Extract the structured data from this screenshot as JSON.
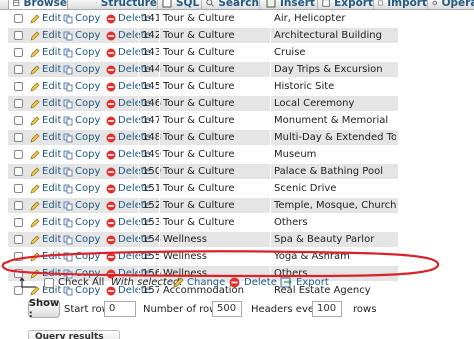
{
  "tabs": [
    {
      "label": "Browse",
      "icon": "browse-icon"
    },
    {
      "label": "Structure",
      "icon": "structure-icon"
    },
    {
      "label": "SQL",
      "icon": "sql-icon"
    },
    {
      "label": "Search",
      "icon": "search-icon"
    },
    {
      "label": "Insert",
      "icon": "insert-icon"
    },
    {
      "label": "Export",
      "icon": "export-icon"
    },
    {
      "label": "Import",
      "icon": "import-icon"
    },
    {
      "label": "Operations",
      "icon": "operations-icon"
    }
  ],
  "actions": {
    "edit": "Edit",
    "copy": "Copy",
    "delete": "Delete"
  },
  "rows": [
    {
      "id": "141",
      "category": "Tour & Culture",
      "name": "Air, Helicopter"
    },
    {
      "id": "142",
      "category": "Tour & Culture",
      "name": "Architectural Building"
    },
    {
      "id": "143",
      "category": "Tour & Culture",
      "name": "Cruise"
    },
    {
      "id": "144",
      "category": "Tour & Culture",
      "name": "Day Trips & Excursion"
    },
    {
      "id": "145",
      "category": "Tour & Culture",
      "name": "Historic Site"
    },
    {
      "id": "146",
      "category": "Tour & Culture",
      "name": "Local Ceremony"
    },
    {
      "id": "147",
      "category": "Tour & Culture",
      "name": "Monument & Memorial"
    },
    {
      "id": "148",
      "category": "Tour & Culture",
      "name": "Multi-Day & Extended Tour"
    },
    {
      "id": "149",
      "category": "Tour & Culture",
      "name": "Museum"
    },
    {
      "id": "150",
      "category": "Tour & Culture",
      "name": "Palace & Bathing Pool"
    },
    {
      "id": "151",
      "category": "Tour & Culture",
      "name": "Scenic Drive"
    },
    {
      "id": "152",
      "category": "Tour & Culture",
      "name": "Temple, Mosque, Church"
    },
    {
      "id": "153",
      "category": "Tour & Culture",
      "name": "Others"
    },
    {
      "id": "154",
      "category": "Wellness",
      "name": "Spa & Beauty Parlor"
    },
    {
      "id": "155",
      "category": "Wellness",
      "name": "Yoga & Ashram"
    },
    {
      "id": "156",
      "category": "Wellness",
      "name": "Others"
    },
    {
      "id": "157",
      "category": "Accommodation",
      "name": "Real Estate Agency"
    }
  ],
  "bulk": {
    "check_all": "Check All",
    "with_selected": "With selected:",
    "change": "Change",
    "delete": "Delete",
    "export": "Export"
  },
  "nav": {
    "show_label": "Show :",
    "start_row_label": "Start row:",
    "start_row_value": "0",
    "num_rows_label": "Number of rows:",
    "num_rows_value": "500",
    "headers_every_label": "Headers every",
    "headers_every_value": "100",
    "rows_label": "rows"
  },
  "query_results_label": "Query results operations",
  "colors": {
    "link": "#235a81",
    "annotation": "#d9232a",
    "row_alt": "#e5e5e5"
  }
}
